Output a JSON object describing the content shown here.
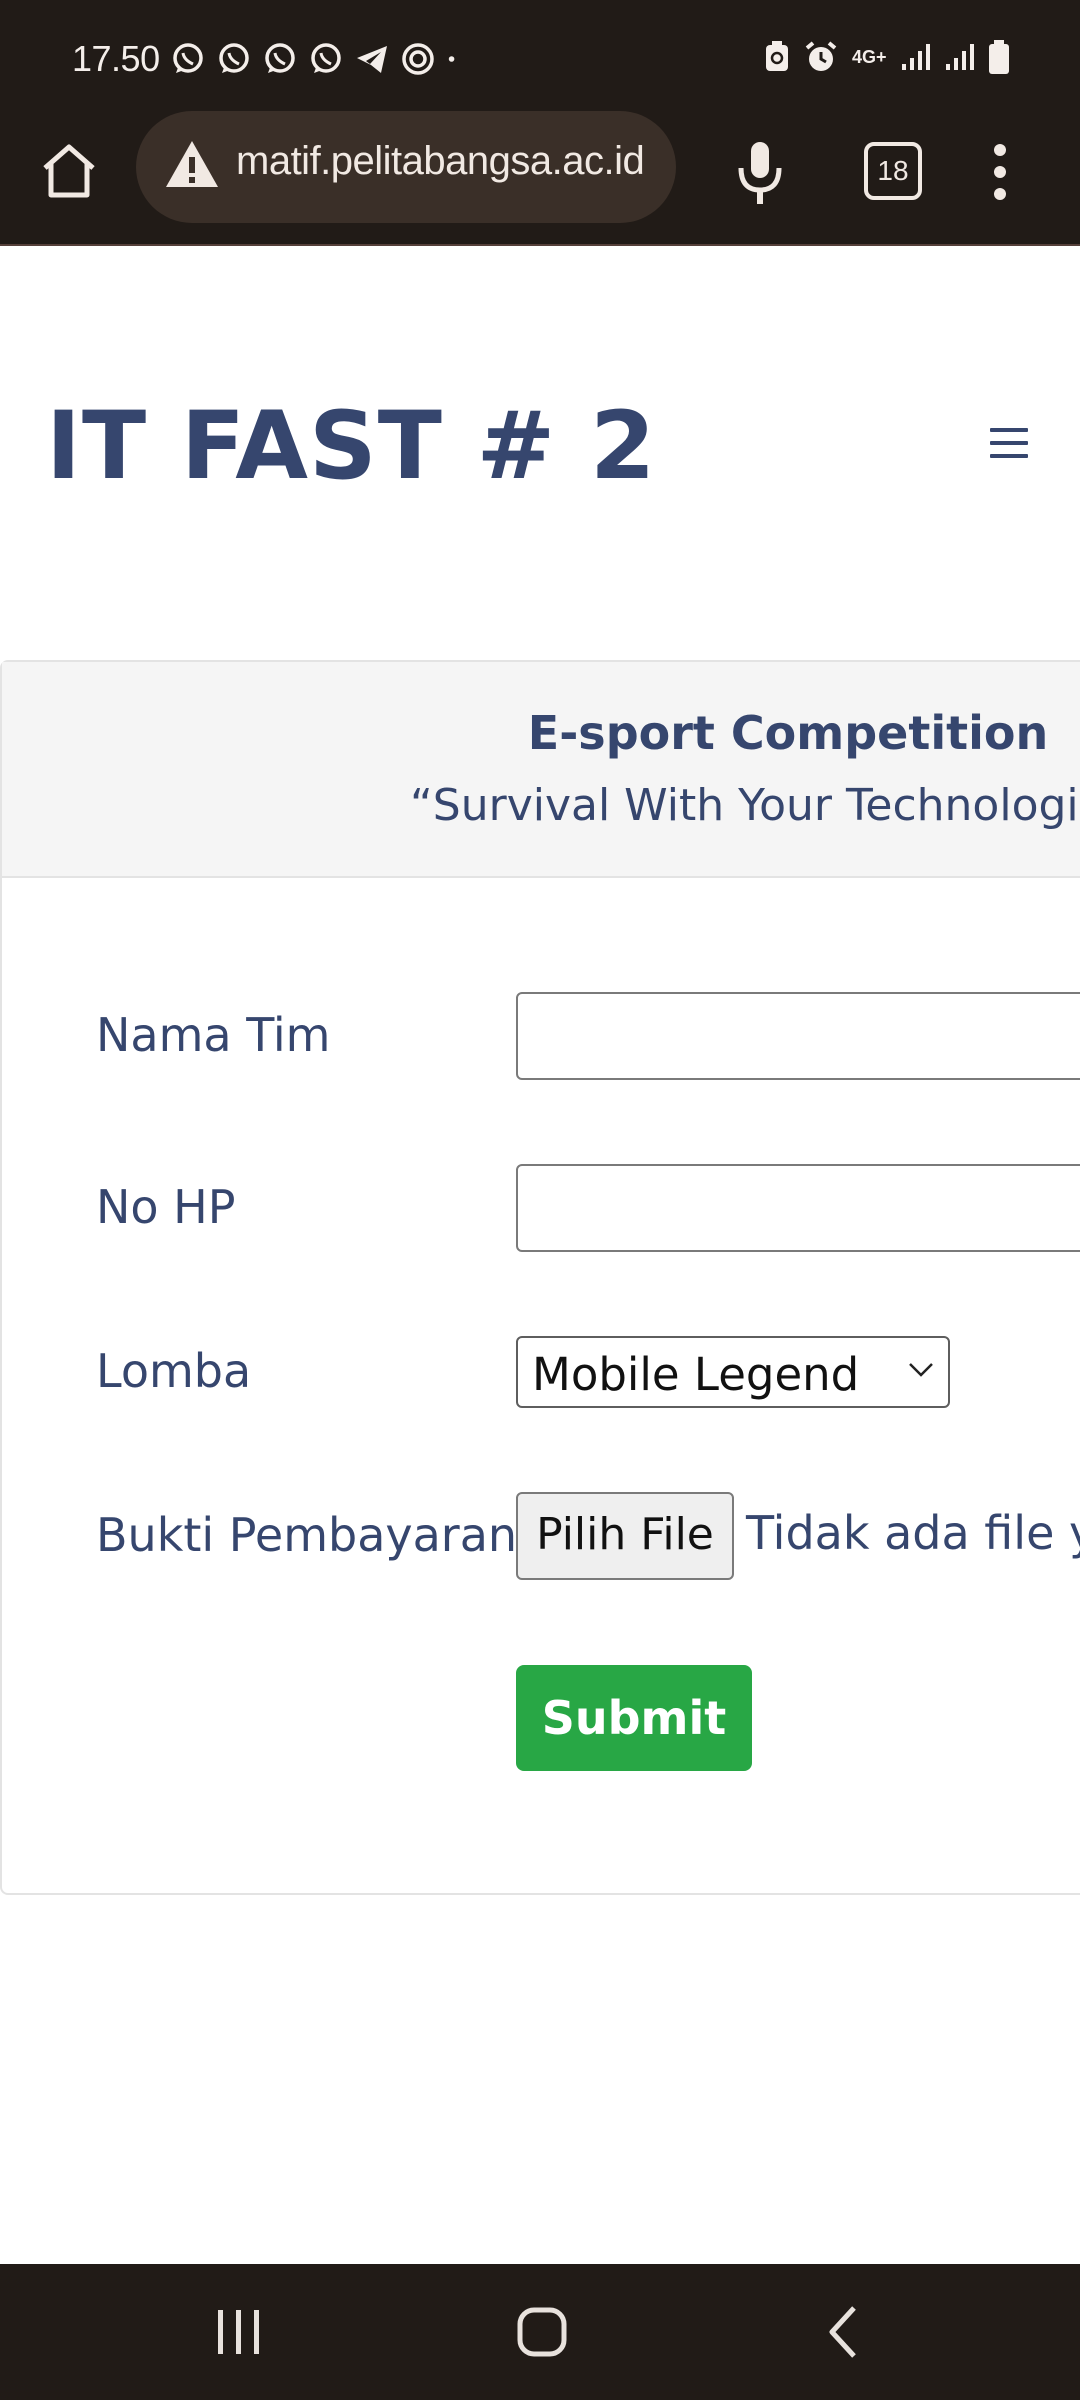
{
  "status_bar": {
    "time": "17.50",
    "notifications": [
      "whatsapp-icon",
      "whatsapp-icon",
      "whatsapp-icon",
      "whatsapp-icon",
      "telegram-icon",
      "target-icon",
      "dot-icon"
    ],
    "network_label": "4G+"
  },
  "browser": {
    "url": "matif.pelitabangsa.ac.id",
    "tab_count": "18"
  },
  "page": {
    "title": "IT FAST # 2",
    "card": {
      "heading": "E-sport Competition",
      "tagline": "“Survival With Your Technologi"
    },
    "form": {
      "team_name_label": "Nama Tim",
      "team_name_value": "",
      "phone_label": "No HP",
      "phone_value": "",
      "competition_label": "Lomba",
      "competition_selected": "Mobile Legend",
      "payment_label": "Bukti Pembayaran",
      "file_button_label": "Pilih File",
      "file_status": "Tidak ada file y",
      "submit_label": "Submit"
    }
  },
  "colors": {
    "system_bar": "#211b17",
    "url_pill": "#3a2f28",
    "brand_text": "#36466e",
    "submit": "#28a745",
    "card_header_bg": "#f5f5f5"
  }
}
